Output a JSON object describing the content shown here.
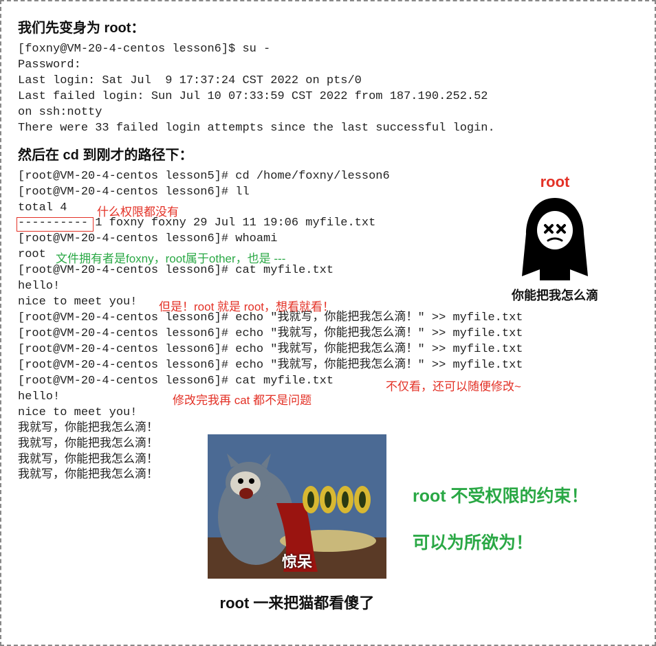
{
  "heading1": "我们先变身为 root：",
  "term1": "[foxny@VM-20-4-centos lesson6]$ su -\nPassword:\nLast login: Sat Jul  9 17:37:24 CST 2022 on pts/0\nLast failed login: Sun Jul 10 07:33:59 CST 2022 from 187.190.252.52\non ssh:notty\nThere were 33 failed login attempts since the last successful login.",
  "heading2": "然后在 cd 到刚才的路径下：",
  "term2_line1": "[root@VM-20-4-centos lesson5]# cd /home/foxny/lesson6",
  "term2_line2": "[root@VM-20-4-centos lesson6]# ll",
  "term2_line3": "total 4",
  "term2_line4": "---------- 1 foxny foxny 29 Jul 11 19:06 myfile.txt",
  "term2_line5": "[root@VM-20-4-centos lesson6]# whoami",
  "term2_line6": "root",
  "term2_line7": "[root@VM-20-4-centos lesson6]# cat myfile.txt",
  "term2_line8": "hello!",
  "term2_line9": "nice to meet you!",
  "term2_echo1": "[root@VM-20-4-centos lesson6]# echo \"我就写，你能把我怎么滴！\" >> myfile.txt",
  "term2_echo2": "[root@VM-20-4-centos lesson6]# echo \"我就写，你能把我怎么滴！\" >> myfile.txt",
  "term2_echo3": "[root@VM-20-4-centos lesson6]# echo \"我就写，你能把我怎么滴！\" >> myfile.txt",
  "term2_echo4": "[root@VM-20-4-centos lesson6]# echo \"我就写，你能把我怎么滴！\" >> myfile.txt",
  "term2_cat2": "[root@VM-20-4-centos lesson6]# cat myfile.txt",
  "term2_out": "hello!\nnice to meet you!\n我就写，你能把我怎么滴！\n我就写，你能把我怎么滴！\n我就写，你能把我怎么滴！\n我就写，你能把我怎么滴！",
  "annot_noperm": "什么权限都没有",
  "annot_owner": "文件拥有者是foxny，root属于other，也是 ---",
  "annot_butroot": "但是！root 就是 root，想看就看！",
  "annot_notonly": "不仅看，还可以随便修改~",
  "annot_aftermod": "修改完我再 cat 都不是问题",
  "reaper_label": "root",
  "reaper_caption": "你能把我怎么滴",
  "tom_text": "惊呆",
  "tom_caption": "root 一来把猫都看傻了",
  "side1": "root 不受权限的约束！",
  "side2": "可以为所欲为！"
}
